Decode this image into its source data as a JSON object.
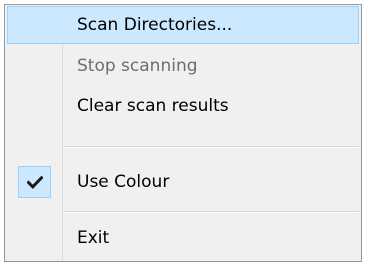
{
  "menu": {
    "items": [
      {
        "label": "Scan Directories...",
        "state": "hovered",
        "checked": false
      },
      {
        "label": "Stop scanning",
        "state": "disabled",
        "checked": false
      },
      {
        "label": "Clear scan results",
        "state": "normal",
        "checked": false
      },
      {
        "label": "Use Colour",
        "state": "normal",
        "checked": true
      },
      {
        "label": "Exit",
        "state": "normal",
        "checked": false
      }
    ],
    "colors": {
      "background": "#f0f0f0",
      "hover_fill": "#cce8ff",
      "hover_border": "#99d1ff",
      "disabled_text": "#6d6d6d",
      "border": "#979797"
    },
    "icons": {
      "check": "checkmark-icon"
    }
  }
}
